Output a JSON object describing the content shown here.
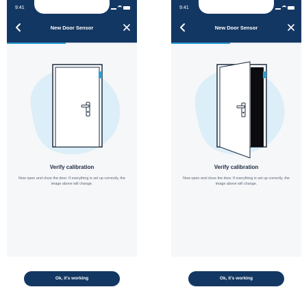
{
  "screens": [
    {
      "status_time": "9:41",
      "header_title": "New Door Sensor",
      "progress_fraction": 0.45,
      "heading": "Verify calibration",
      "body": "Now open and close the door. If everything is set up correctly, the image above will change.",
      "button_label": "Ok, it's working",
      "door_state": "closed"
    },
    {
      "status_time": "9:41",
      "header_title": "New Door Sensor",
      "progress_fraction": 0.45,
      "heading": "Verify calibration",
      "body": "Now open and close the door. If everything is set up correctly, the image above will change.",
      "button_label": "Ok, it's working",
      "door_state": "open"
    }
  ],
  "colors": {
    "header_bg": "#133763",
    "accent": "#2ca1d5",
    "sensor": "#2ca1d5",
    "blob": "#d7ecf7"
  },
  "icons": {
    "back": "chevron-left-icon",
    "close": "close-icon"
  }
}
